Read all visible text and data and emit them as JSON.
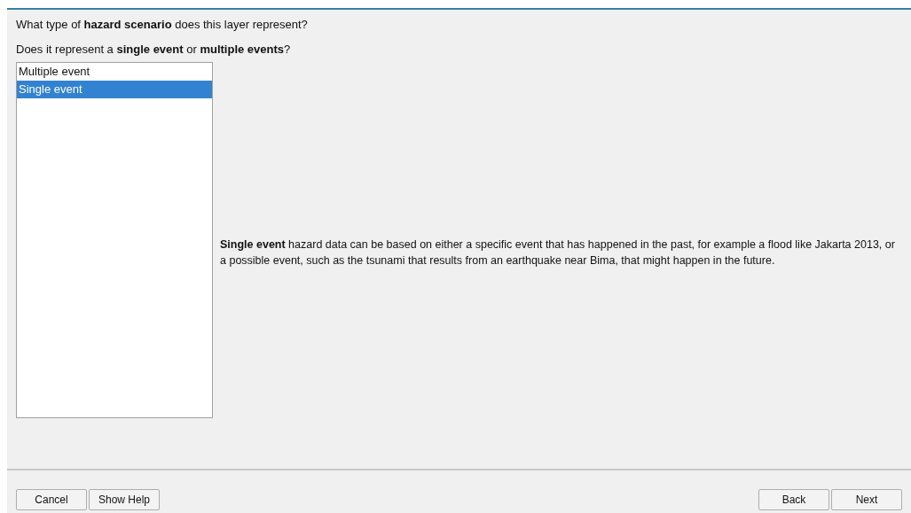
{
  "question": "What type of **hazard scenario** does this layer represent?",
  "subquestion": "Does it represent a **single event** or **multiple events**?",
  "options": [
    {
      "label": "Multiple event",
      "selected": false
    },
    {
      "label": "Single event",
      "selected": true
    }
  ],
  "description": "**Single event** hazard data can be based on either a specific event that has happened in the past, for example a flood like Jakarta 2013, or a possible event, such as the tsunami that results from an earthquake near Bima, that might happen in the future.",
  "buttons_left": [
    "Cancel",
    "Show Help"
  ],
  "buttons_right": [
    "Back",
    "Next"
  ]
}
